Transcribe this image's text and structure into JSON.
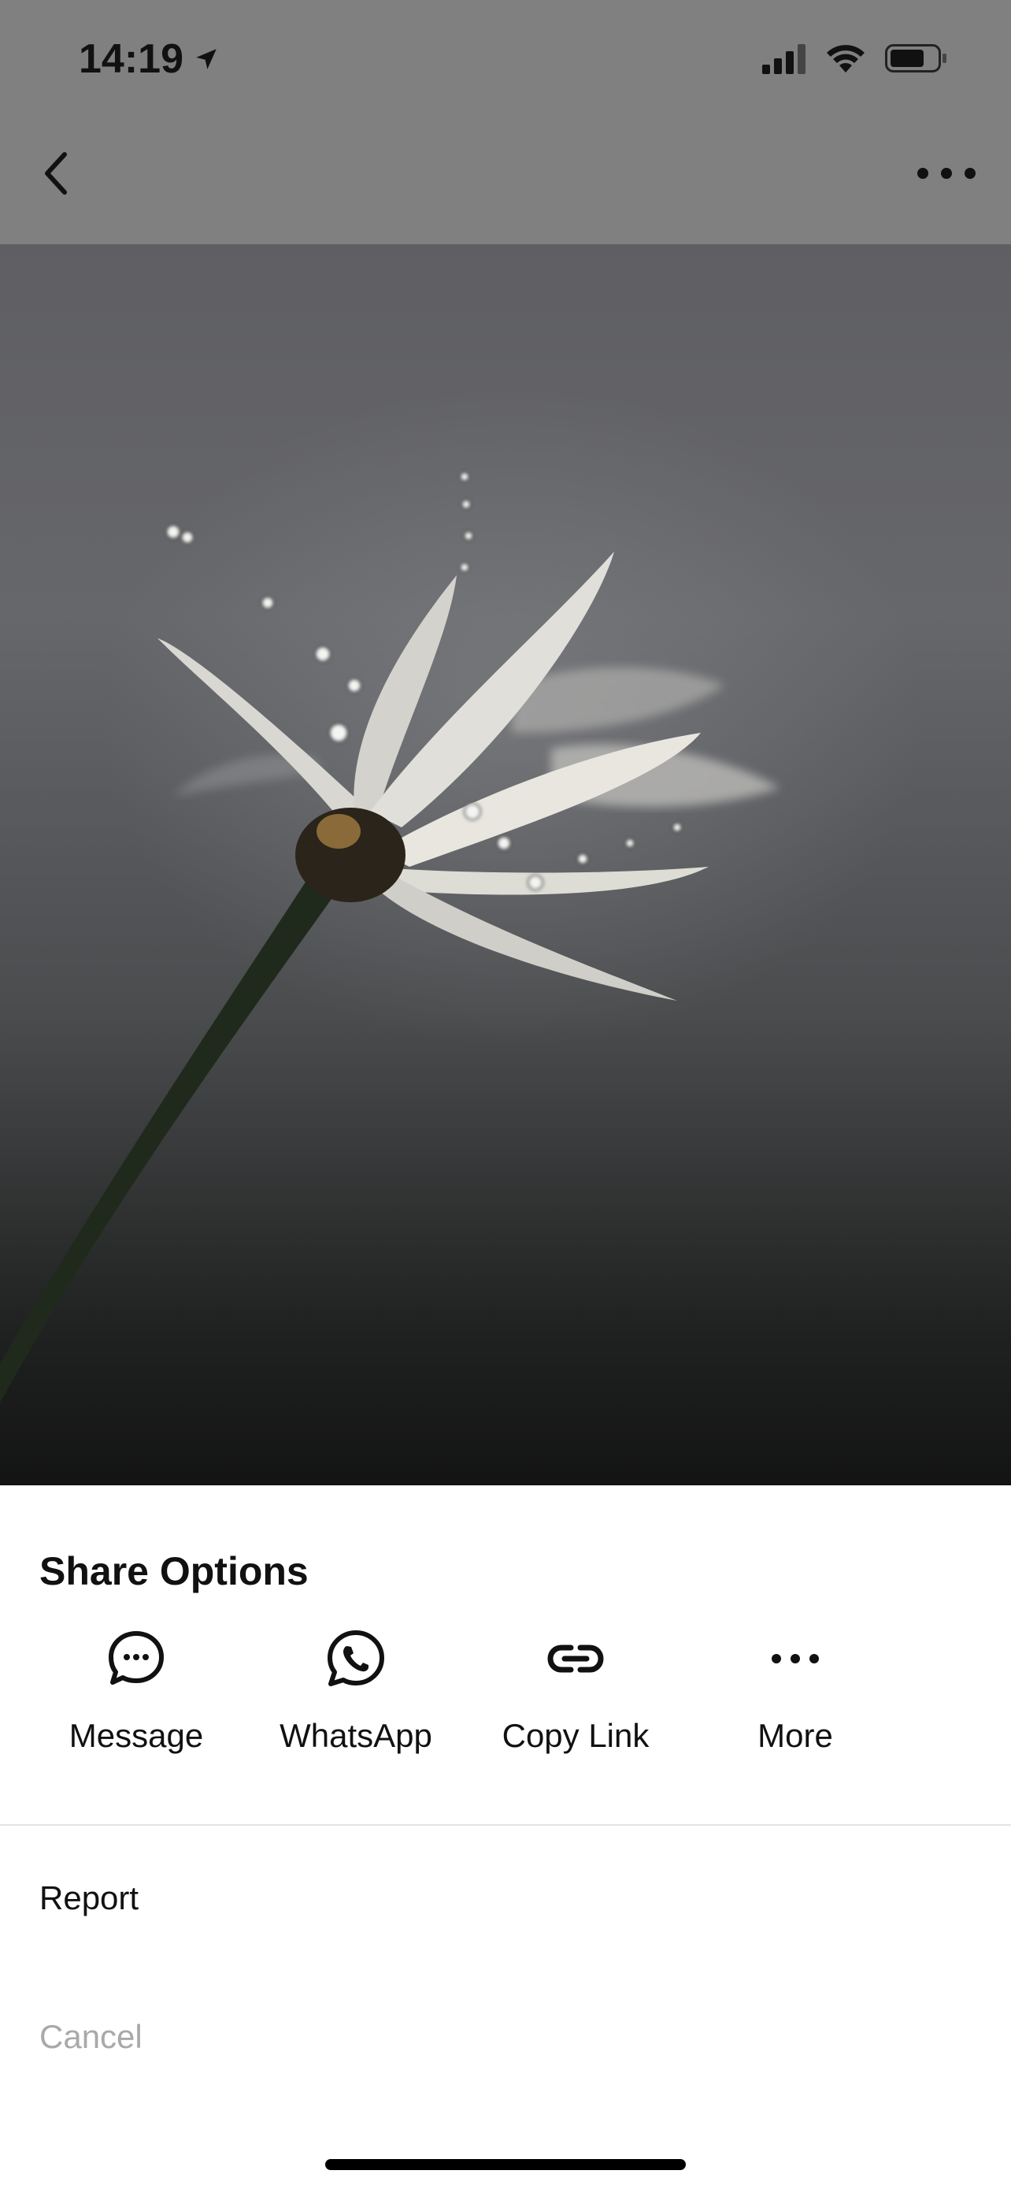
{
  "status_bar": {
    "time": "14:19",
    "icons": [
      "location-arrow-icon",
      "signal-icon",
      "wifi-icon",
      "battery-icon"
    ]
  },
  "nav": {
    "back_icon": "chevron-left-icon",
    "more_icon": "ellipsis-icon"
  },
  "photo": {
    "subject": "white daisy with water droplets"
  },
  "share_sheet": {
    "title": "Share Options",
    "options": [
      {
        "label": "Message",
        "icon": "message-bubble-icon"
      },
      {
        "label": "WhatsApp",
        "icon": "whatsapp-icon"
      },
      {
        "label": "Copy Link",
        "icon": "link-icon"
      },
      {
        "label": "More",
        "icon": "ellipsis-icon"
      }
    ],
    "report_label": "Report",
    "cancel_label": "Cancel"
  },
  "colors": {
    "overlay_top": "#808080",
    "sheet_bg": "#ffffff",
    "text": "#111111",
    "cancel_text": "#a9a9a9",
    "divider": "#e4e4e4"
  }
}
